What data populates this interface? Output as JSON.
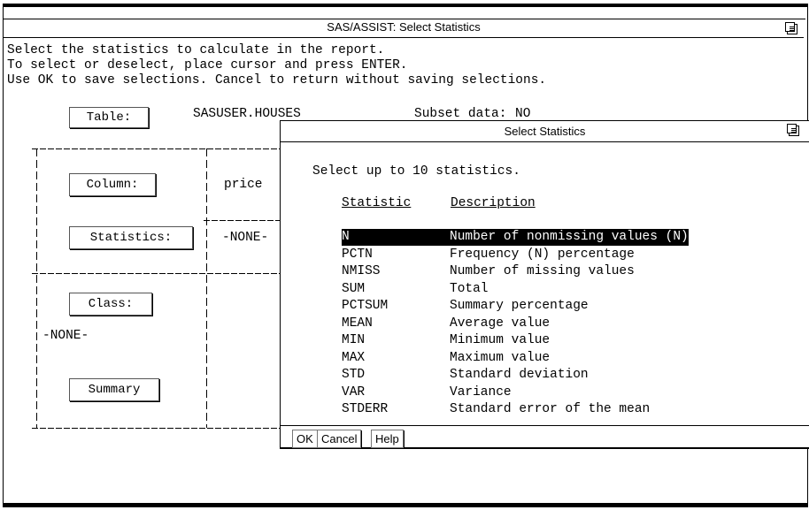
{
  "window": {
    "title": "SAS/ASSIST: Select Statistics"
  },
  "instructions": [
    "Select the statistics to calculate in the report.",
    "To select or deselect, place cursor and press ENTER.",
    "Use OK to save selections. Cancel to return without saving selections."
  ],
  "form": {
    "table_button": "Table:",
    "table_value": "SASUSER.HOUSES",
    "subset_label": "Subset data:",
    "subset_value": "NO",
    "column_button": "Column:",
    "column_value": "price",
    "statistics_button": "Statistics:",
    "statistics_value": "-NONE-",
    "class_button": "Class:",
    "class_value": "-NONE-",
    "summary_button": "Summary"
  },
  "dialog": {
    "title": "Select Statistics",
    "prompt": "Select up to 10 statistics.",
    "col_statistic": "Statistic",
    "col_description": "Description",
    "rows": [
      {
        "code": "N",
        "desc": "Number of nonmissing values (N)",
        "selected": true
      },
      {
        "code": "PCTN",
        "desc": "Frequency (N) percentage"
      },
      {
        "code": "NMISS",
        "desc": "Number of missing values"
      },
      {
        "code": "SUM",
        "desc": "Total"
      },
      {
        "code": "PCTSUM",
        "desc": "Summary percentage"
      },
      {
        "code": "MEAN",
        "desc": "Average value"
      },
      {
        "code": "MIN",
        "desc": "Minimum value"
      },
      {
        "code": "MAX",
        "desc": "Maximum value"
      },
      {
        "code": "STD",
        "desc": "Standard deviation"
      },
      {
        "code": "VAR",
        "desc": "Variance"
      },
      {
        "code": "STDERR",
        "desc": "Standard error of the mean"
      }
    ],
    "ok": "OK",
    "cancel": "Cancel",
    "help": "Help"
  }
}
